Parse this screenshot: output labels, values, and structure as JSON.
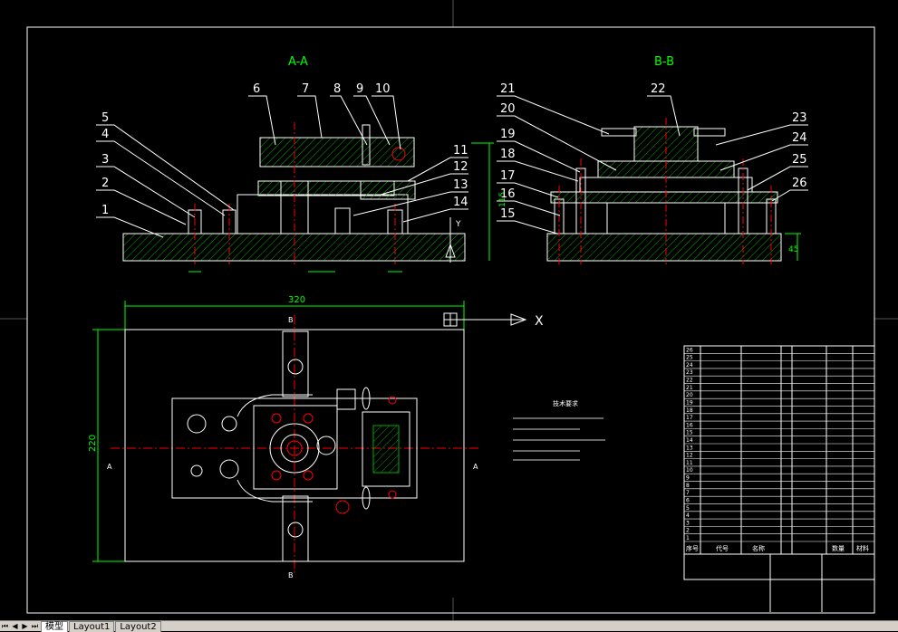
{
  "drawing": {
    "section_a_title": "A-A",
    "section_b_title": "B-B",
    "part_callouts_a": [
      "1",
      "2",
      "3",
      "4",
      "5",
      "6",
      "7",
      "8",
      "9",
      "10",
      "11",
      "12",
      "13",
      "14"
    ],
    "part_callouts_b": [
      "15",
      "16",
      "17",
      "18",
      "19",
      "20",
      "21",
      "22",
      "23",
      "24",
      "25",
      "26"
    ],
    "dim_width": "320",
    "dim_height": "220",
    "dim_a_right": "115",
    "dim_b_right": "45",
    "ucs_x_label": "X",
    "ucs_y_label": "Y",
    "cut_label_a": "A",
    "cut_label_b": "B",
    "tech_req_title": "技术要求"
  },
  "bom": {
    "rows": [
      "26",
      "25",
      "24",
      "23",
      "22",
      "21",
      "20",
      "19",
      "18",
      "17",
      "16",
      "15",
      "14",
      "13",
      "12",
      "11",
      "10",
      "9",
      "8",
      "7",
      "6",
      "5",
      "4",
      "3",
      "2",
      "1"
    ],
    "header_cols": [
      "序号",
      "代号",
      "名称",
      "数量",
      "材料"
    ]
  },
  "tabs": {
    "model": "模型",
    "layout1": "Layout1",
    "layout2": "Layout2"
  },
  "colors": {
    "background": "#000000",
    "outline": "#ffffff",
    "dimension": "#00ff00",
    "centerline": "#ff0000",
    "hatch": "#00aa00",
    "accent": "#ffff00"
  }
}
